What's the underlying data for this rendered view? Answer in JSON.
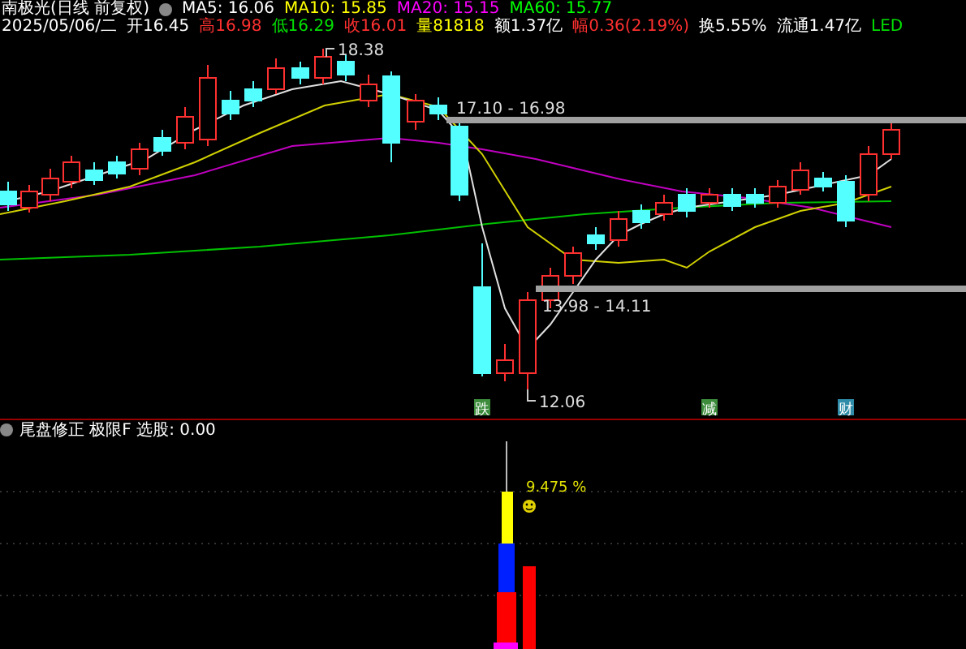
{
  "header": {
    "title": "南极光(日线 前复权)",
    "moving_averages": [
      {
        "text": "MA5: 16.06",
        "color": "#ffffff"
      },
      {
        "text": "MA10: 15.85",
        "color": "#ffff00"
      },
      {
        "text": "MA20: 15.15",
        "color": "#ff00ff"
      },
      {
        "text": "MA60: 15.77",
        "color": "#00ff00"
      }
    ],
    "quote": [
      {
        "text": "2025/05/06/二",
        "color": "#ffffff"
      },
      {
        "text": "开16.45",
        "color": "#ffffff"
      },
      {
        "text": "高16.98",
        "color": "#ff3030"
      },
      {
        "text": "低16.29",
        "color": "#00e000"
      },
      {
        "text": "收16.01",
        "color": "#ff3030"
      },
      {
        "text": "量81818",
        "color": "#ffff00"
      },
      {
        "text": "额1.37亿",
        "color": "#ffffff"
      },
      {
        "text": "幅0.36(2.19%)",
        "color": "#ff3030"
      },
      {
        "text": "换5.55%",
        "color": "#ffffff"
      },
      {
        "text": "流通1.47亿",
        "color": "#ffffff"
      },
      {
        "text": "LED",
        "color": "#00e000"
      }
    ]
  },
  "price_chart": {
    "annotations": [
      "18.38",
      "17.10 - 16.98",
      "13.98 - 14.11",
      "12.06"
    ],
    "markers": [
      {
        "text": "跌",
        "color": "#3c8c3c"
      },
      {
        "text": "减",
        "color": "#3c8c3c"
      },
      {
        "text": "财",
        "color": "#2e8ca8"
      }
    ]
  },
  "indicator": {
    "title": "尾盘修正 极限F 选股: 0.00",
    "reading": "9.475 %"
  }
}
